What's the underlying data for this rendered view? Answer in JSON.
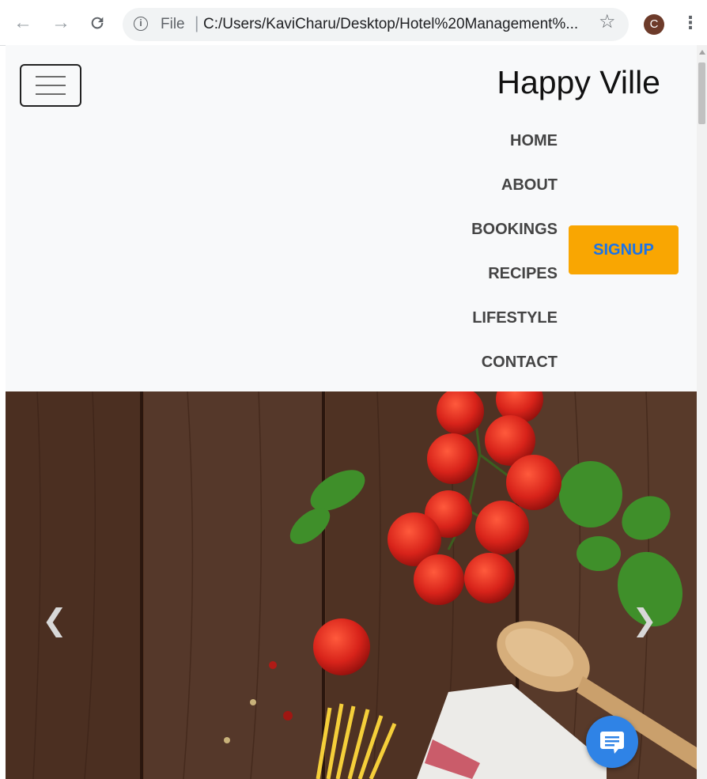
{
  "browser": {
    "scheme_label": "File",
    "url": "C:/Users/KaviCharu/Desktop/Hotel%20Management%...",
    "profile_initial": "C",
    "icons": [
      "back-arrow-icon",
      "forward-arrow-icon",
      "reload-icon",
      "info-icon",
      "star-icon",
      "more-vert-icon"
    ]
  },
  "site": {
    "brand": "Happy Ville",
    "nav": [
      "HOME",
      "ABOUT",
      "BOOKINGS",
      "RECIPES",
      "LIFESTYLE",
      "CONTACT"
    ],
    "signup_label": "SIGNUP",
    "colors": {
      "signup_bg": "#f9a602",
      "signup_text": "#1a73e8",
      "navbar_bg": "#f8f9fa",
      "chat_fab": "#2f83e6"
    }
  },
  "hero": {
    "description_icons": [
      "chevron-left-icon",
      "chevron-right-icon",
      "chat-icon"
    ]
  }
}
